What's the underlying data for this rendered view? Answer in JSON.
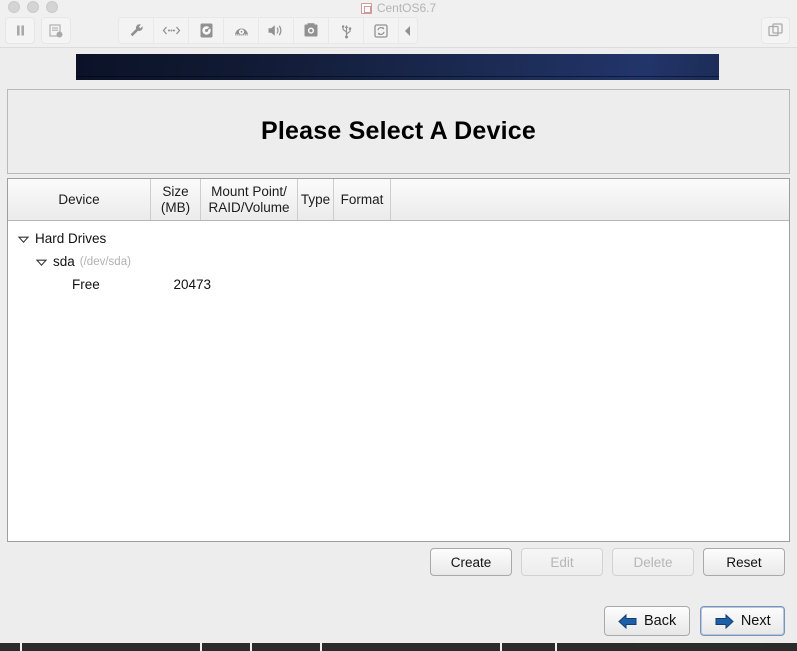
{
  "window": {
    "title": "CentOS6.7",
    "title_icon": "vm-screen-icon",
    "controls": {
      "pause": "pause-icon",
      "snapshot": "snapshot-icon",
      "scale_mode": "scale-mode-icon"
    },
    "toolbar_items": [
      {
        "name": "settings-icon",
        "glyph": "wrench"
      },
      {
        "name": "network-icon",
        "glyph": "network"
      },
      {
        "name": "hard-disk-icon",
        "glyph": "hdd"
      },
      {
        "name": "optical-drive-icon",
        "glyph": "optical"
      },
      {
        "name": "audio-icon",
        "glyph": "speaker"
      },
      {
        "name": "screenshot-icon",
        "glyph": "camera"
      },
      {
        "name": "usb-icon",
        "glyph": "usb"
      },
      {
        "name": "shared-folders-icon",
        "glyph": "sync"
      },
      {
        "name": "collapse-toolbar-icon",
        "glyph": "triangle-left"
      }
    ]
  },
  "banner": {
    "name": "installer-banner",
    "color_left": "#0b1228",
    "color_right": "#22356a"
  },
  "page": {
    "heading": "Please Select A Device"
  },
  "table": {
    "columns": [
      {
        "key": "device",
        "label": "Device"
      },
      {
        "key": "size",
        "label": "Size\n(MB)"
      },
      {
        "key": "mount",
        "label": "Mount Point/\nRAID/Volume"
      },
      {
        "key": "type",
        "label": "Type"
      },
      {
        "key": "format",
        "label": "Format"
      }
    ],
    "rows": [
      {
        "name": "Hard Drives",
        "path": "",
        "size": "",
        "mount": "",
        "type": "",
        "format": "",
        "expanded": true,
        "level": 0
      },
      {
        "name": "sda",
        "path": "(/dev/sda)",
        "size": "",
        "mount": "",
        "type": "",
        "format": "",
        "expanded": true,
        "level": 1
      },
      {
        "name": "Free",
        "path": "",
        "size": "20473",
        "mount": "",
        "type": "",
        "format": "",
        "expanded": false,
        "level": 2
      }
    ]
  },
  "actions": {
    "create": {
      "label": "Create",
      "enabled": true
    },
    "edit": {
      "label": "Edit",
      "enabled": false
    },
    "delete": {
      "label": "Delete",
      "enabled": false
    },
    "reset": {
      "label": "Reset",
      "enabled": true
    }
  },
  "navigation": {
    "back": {
      "label": "Back",
      "icon": "arrow-left-icon"
    },
    "next": {
      "label": "Next",
      "icon": "arrow-right-icon",
      "focused": true
    }
  }
}
